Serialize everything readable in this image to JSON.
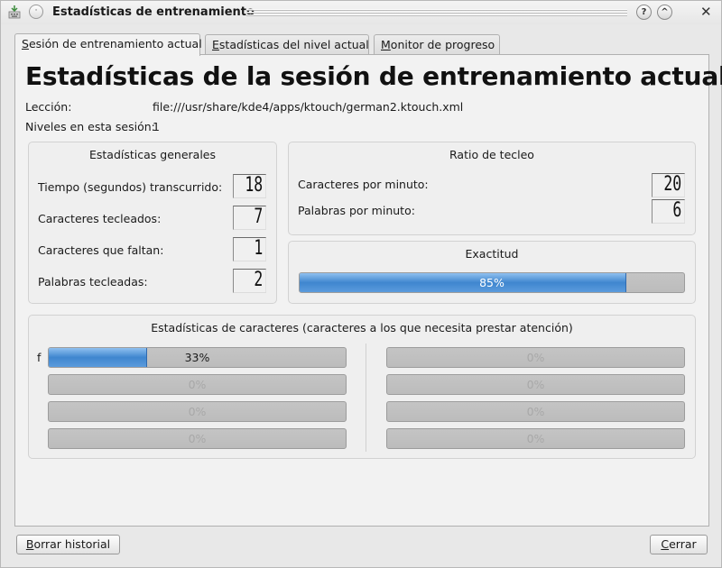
{
  "window": {
    "title": "Estadísticas de entrenamiento",
    "menu_glyph": "·",
    "help_glyph": "?",
    "shade_glyph": "^",
    "close_glyph": "✕"
  },
  "tabs": [
    {
      "prefix": "",
      "accel": "S",
      "rest": "esión de entrenamiento actual",
      "active": true
    },
    {
      "prefix": "",
      "accel": "E",
      "rest": "stadísticas del nivel actual",
      "active": false
    },
    {
      "prefix": "",
      "accel": "M",
      "rest": "onitor de progreso",
      "active": false
    }
  ],
  "session": {
    "heading": "Estadísticas de la sesión de entrenamiento actual",
    "lesson_label": "Lección:",
    "lesson_value": "file:///usr/share/kde4/apps/ktouch/german2.ktouch.xml",
    "levels_label": "Niveles en esta sesión:",
    "levels_value": "1"
  },
  "general_stats": {
    "title": "Estadísticas generales",
    "rows": [
      {
        "label": "Tiempo (segundos) transcurrido:",
        "value": "18"
      },
      {
        "label": "Caracteres tecleados:",
        "value": "7"
      },
      {
        "label": "Caracteres que faltan:",
        "value": "1"
      },
      {
        "label": "Palabras tecleadas:",
        "value": "2"
      }
    ]
  },
  "typing_rate": {
    "title": "Ratio de tecleo",
    "rows": [
      {
        "label": "Caracteres por minuto:",
        "value": "20"
      },
      {
        "label": "Palabras por minuto:",
        "value": "6"
      }
    ]
  },
  "accuracy": {
    "title": "Exactitud",
    "percent": 85,
    "text": "85%"
  },
  "char_stats": {
    "title": "Estadísticas de caracteres (caracteres a los que necesita prestar atención)",
    "left": [
      {
        "char": "f",
        "percent": 33,
        "text": "33%"
      },
      {
        "char": "",
        "percent": 0,
        "text": "0%"
      },
      {
        "char": "",
        "percent": 0,
        "text": "0%"
      },
      {
        "char": "",
        "percent": 0,
        "text": "0%"
      }
    ],
    "right": [
      {
        "char": "",
        "percent": 0,
        "text": "0%"
      },
      {
        "char": "",
        "percent": 0,
        "text": "0%"
      },
      {
        "char": "",
        "percent": 0,
        "text": "0%"
      },
      {
        "char": "",
        "percent": 0,
        "text": "0%"
      }
    ]
  },
  "buttons": {
    "clear_accel": "B",
    "clear_rest": "orrar historial",
    "close_accel": "C",
    "close_rest": "errar"
  },
  "colors": {
    "progress_fill": "#4a8fd6",
    "progress_track": "#c0c0c0"
  }
}
